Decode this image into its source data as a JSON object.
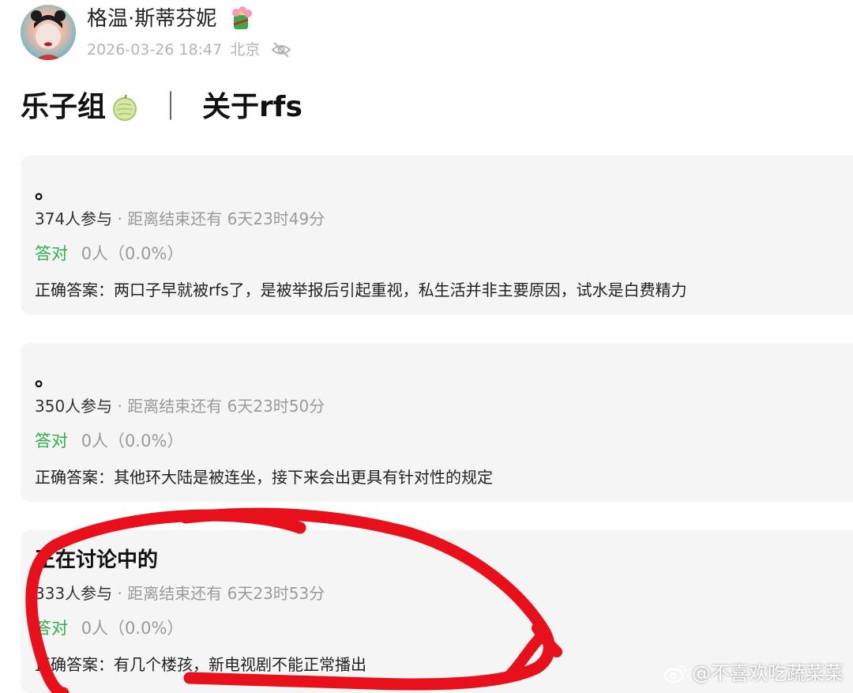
{
  "post": {
    "author": "格温·斯蒂芬妮",
    "date": "2026-03-26 18:47",
    "location": "北京",
    "title_left": "乐子组",
    "title_sep": "｜",
    "title_right": "关于rfs"
  },
  "quizzes": [
    {
      "question": "。",
      "participants": "374人参与",
      "remaining": "· 距离结束还有 6天23时49分",
      "correct_label": "答对",
      "correct_value": "0人（0.0%）",
      "answer": "正确答案：两口子早就被rfs了，是被举报后引起重视，私生活并非主要原因，试水是白费精力"
    },
    {
      "question": "。",
      "participants": "350人参与",
      "remaining": "· 距离结束还有 6天23时50分",
      "correct_label": "答对",
      "correct_value": "0人（0.0%）",
      "answer": "正确答案：其他环大陆是被连坐，接下来会出更具有针对性的规定"
    },
    {
      "question": "正在讨论中的",
      "participants": "333人参与",
      "remaining": "· 距离结束还有 6天23时53分",
      "correct_label": "答对",
      "correct_value": "0人（0.0%）",
      "answer": "正确答案：有几个楼孩，新电视剧不能正常播出"
    }
  ],
  "watermark": "@不喜欢吃蔬菜菜",
  "colors": {
    "correct_green": "#2fb14e",
    "muted_gray": "#9a9a9a",
    "card_bg": "#f5f5f5",
    "scribble_red": "#e8101a"
  },
  "icons": [
    "avatar",
    "badge-icon",
    "eye-off-icon",
    "melon-icon",
    "weibo-icon"
  ]
}
